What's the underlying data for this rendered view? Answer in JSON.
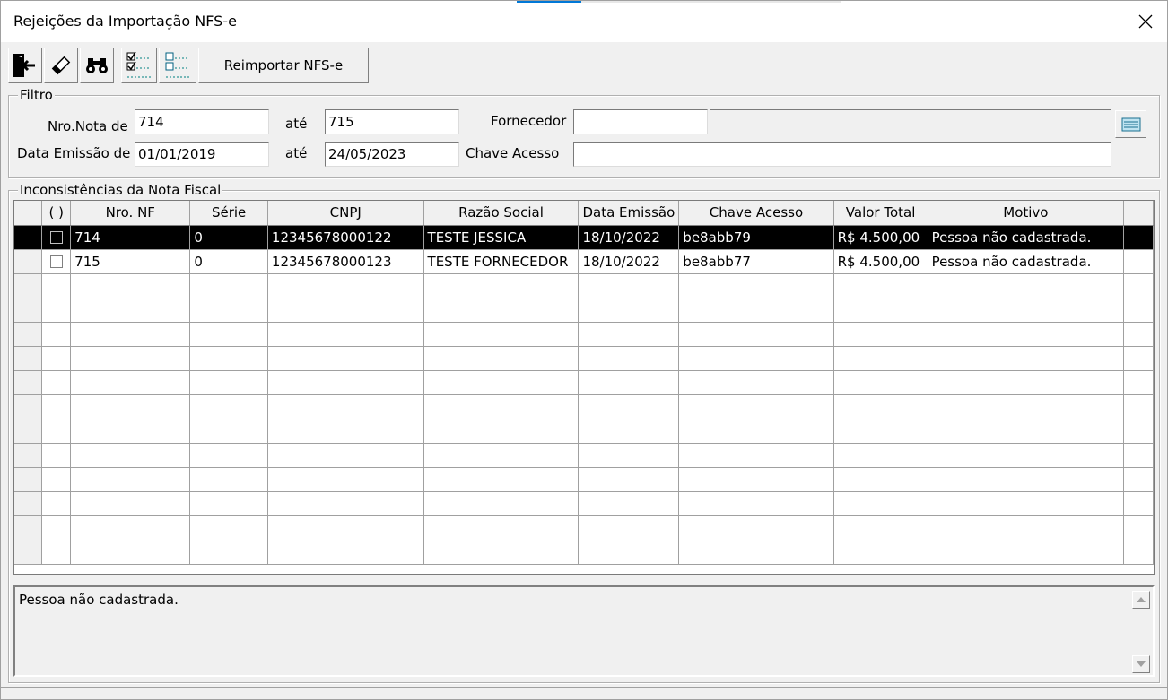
{
  "window": {
    "title": "Rejeições da Importação NFS-e",
    "close_icon": "close-icon"
  },
  "toolbar": {
    "exit_icon": "exit-door-icon",
    "clear_icon": "eraser-icon",
    "search_icon": "binoculars-icon",
    "check_all_icon": "check-all-icon",
    "uncheck_all_icon": "uncheck-all-icon",
    "reimport_label": "Reimportar NFS-e"
  },
  "filter": {
    "title": "Filtro",
    "nro_nota_label": "Nro.Nota de",
    "nro_nota_from": "714",
    "ate_label": "até",
    "nro_nota_to": "715",
    "fornecedor_label": "Fornecedor",
    "fornecedor_code": "",
    "fornecedor_name": "",
    "fornecedor_lookup_icon": "list-lookup-icon",
    "data_emissao_label": "Data Emissão de",
    "data_from": "01/01/2019",
    "data_to": "24/05/2023",
    "chave_label": "Chave Acesso",
    "chave_value": ""
  },
  "grid": {
    "title": "Inconsistências da Nota Fiscal",
    "columns": [
      "( )",
      "Nro. NF",
      "Série",
      "CNPJ",
      "Razão Social",
      "Data Emissão",
      "Chave Acesso",
      "Valor Total",
      "Motivo"
    ],
    "rows": [
      {
        "nf": "714",
        "serie": "0",
        "cnpj": "12345678000122",
        "razao": "TESTE JESSICA",
        "data": "18/10/2022",
        "chave": "be8abb79",
        "valor": "R$ 4.500,00",
        "motivo": "Pessoa não cadastrada.",
        "selected": true
      },
      {
        "nf": "715",
        "serie": "0",
        "cnpj": "12345678000123",
        "razao": "TESTE FORNECEDOR",
        "data": "18/10/2022",
        "chave": "be8abb77",
        "valor": "R$ 4.500,00",
        "motivo": "Pessoa não cadastrada.",
        "selected": false
      }
    ]
  },
  "memo": {
    "text": "Pessoa não cadastrada."
  },
  "colors": {
    "window_bg": "#f0f0f0",
    "selected_row_bg": "#000000",
    "accent": "#0078d7"
  }
}
